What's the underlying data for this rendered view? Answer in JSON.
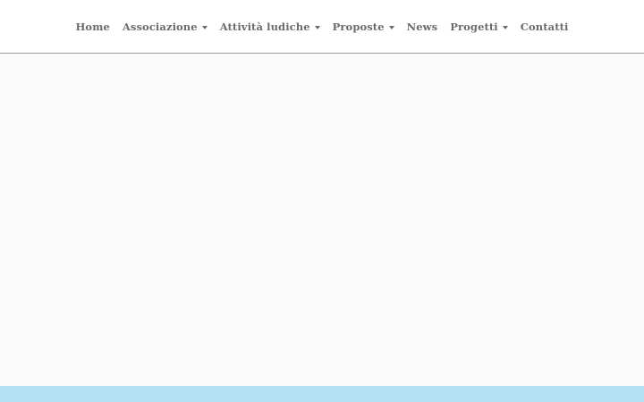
{
  "nav": {
    "items": [
      {
        "label": "Home",
        "has_dropdown": false
      },
      {
        "label": "Associazione",
        "has_dropdown": true
      },
      {
        "label": "Attività ludiche",
        "has_dropdown": true
      },
      {
        "label": "Proposte",
        "has_dropdown": true
      },
      {
        "label": "News",
        "has_dropdown": false
      },
      {
        "label": "Progetti",
        "has_dropdown": true
      },
      {
        "label": "Contatti",
        "has_dropdown": false
      }
    ]
  },
  "colors": {
    "nav_text": "#6b6b6b",
    "header_bg": "#ffffff",
    "page_bg": "#fafafa",
    "footer_band": "#b3e1f4"
  },
  "icons": {
    "dropdown": "chevron-down-icon"
  }
}
